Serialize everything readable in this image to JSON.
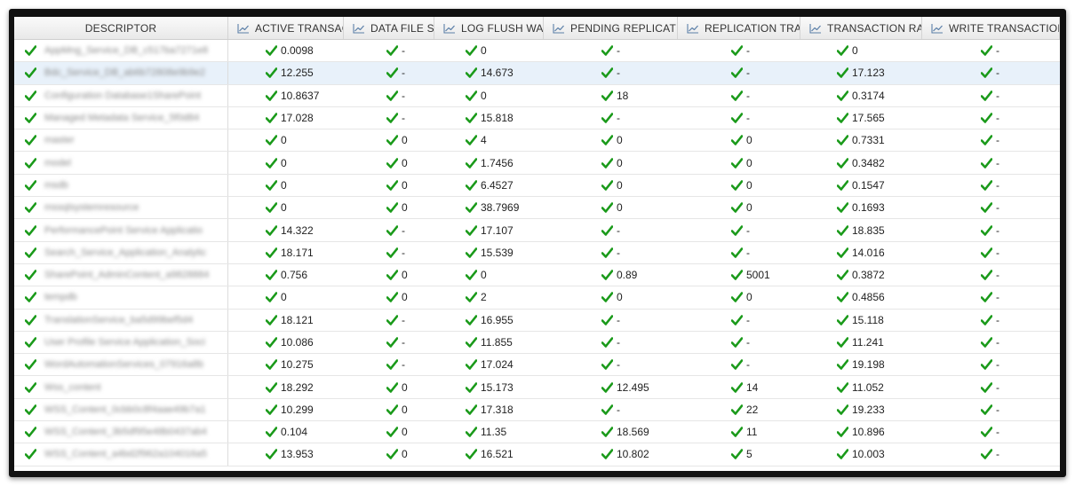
{
  "table": {
    "columns": [
      "DESCRIPTOR",
      "ACTIVE TRANSACTIONS",
      "DATA FILE SIZE",
      "LOG FLUSH WAITS",
      "PENDING REPLICATION",
      "REPLICATION TRANSACTIONS",
      "TRANSACTION RATE",
      "WRITE TRANSACTIONS"
    ],
    "selected_row": 1,
    "status_color": "#1a9a1a",
    "rows": [
      {
        "descriptor": "AppMng_Service_DB_c517ba7271e8",
        "values": [
          "0.0098",
          "-",
          "0",
          "-",
          "-",
          "0",
          "-"
        ]
      },
      {
        "descriptor": "Bdc_Service_DB_ab6b72808e9b9e2",
        "values": [
          "12.255",
          "-",
          "14.673",
          "-",
          "-",
          "17.123",
          "-"
        ]
      },
      {
        "descriptor": "Configuration Database1SharePoint",
        "values": [
          "10.8637",
          "-",
          "0",
          "18",
          "-",
          "0.3174",
          "-"
        ]
      },
      {
        "descriptor": "Managed Metadata Service_5f0d84",
        "values": [
          "17.028",
          "-",
          "15.818",
          "-",
          "-",
          "17.565",
          "-"
        ]
      },
      {
        "descriptor": "master",
        "values": [
          "0",
          "0",
          "4",
          "0",
          "0",
          "0.7331",
          "-"
        ]
      },
      {
        "descriptor": "model",
        "values": [
          "0",
          "0",
          "1.7456",
          "0",
          "0",
          "0.3482",
          "-"
        ]
      },
      {
        "descriptor": "msdb",
        "values": [
          "0",
          "0",
          "6.4527",
          "0",
          "0",
          "0.1547",
          "-"
        ]
      },
      {
        "descriptor": "mssqlsystemresource",
        "values": [
          "0",
          "0",
          "38.7969",
          "0",
          "0",
          "0.1693",
          "-"
        ]
      },
      {
        "descriptor": "PerformancePoint Service Applicatio",
        "values": [
          "14.322",
          "-",
          "17.107",
          "-",
          "-",
          "18.835",
          "-"
        ]
      },
      {
        "descriptor": "Search_Service_Application_Analytic",
        "values": [
          "18.171",
          "-",
          "15.539",
          "-",
          "-",
          "14.016",
          "-"
        ]
      },
      {
        "descriptor": "SharePoint_AdminContent_a9828884",
        "values": [
          "0.756",
          "0",
          "0",
          "0.89",
          "5001",
          "0.3872",
          "-"
        ]
      },
      {
        "descriptor": "tempdb",
        "values": [
          "0",
          "0",
          "2",
          "0",
          "0",
          "0.4856",
          "-"
        ]
      },
      {
        "descriptor": "TranslationService_ba5d99bef5d4",
        "values": [
          "18.121",
          "-",
          "16.955",
          "-",
          "-",
          "15.118",
          "-"
        ]
      },
      {
        "descriptor": "User Profile Service Application_Soci",
        "values": [
          "10.086",
          "-",
          "11.855",
          "-",
          "-",
          "11.241",
          "-"
        ]
      },
      {
        "descriptor": "WordAutomationServices_07916a8b",
        "values": [
          "10.275",
          "-",
          "17.024",
          "-",
          "-",
          "19.198",
          "-"
        ]
      },
      {
        "descriptor": "Wss_content",
        "values": [
          "18.292",
          "0",
          "15.173",
          "12.495",
          "14",
          "11.052",
          "-"
        ]
      },
      {
        "descriptor": "WSS_Content_0cbb0c8f4aae49b7a1",
        "values": [
          "10.299",
          "0",
          "17.318",
          "-",
          "22",
          "19.233",
          "-"
        ]
      },
      {
        "descriptor": "WSS_Content_3b5df95e48b0437ab4",
        "values": [
          "0.104",
          "0",
          "11.35",
          "18.569",
          "11",
          "10.896",
          "-"
        ]
      },
      {
        "descriptor": "WSS_Content_a4bd2f962a104016a5",
        "values": [
          "13.953",
          "0",
          "16.521",
          "10.802",
          "5",
          "10.003",
          "-"
        ]
      }
    ]
  },
  "icons": {
    "header_metric": "line-chart-icon",
    "status": "check-icon"
  }
}
